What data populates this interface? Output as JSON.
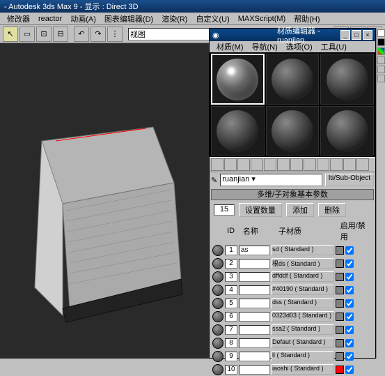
{
  "app": {
    "title": "- Autodesk 3ds Max 9 - 显示 : Direct 3D"
  },
  "menu": {
    "items": [
      "修改器",
      "reactor",
      "动画(A)",
      "图表编辑器(D)",
      "渲染(R)",
      "自定义(U)",
      "MAXScript(M)",
      "帮助(H)"
    ]
  },
  "viewport": {
    "label": "视图"
  },
  "material_editor": {
    "title": "材质编辑器 - ruanjian",
    "icon": "◉",
    "menu": [
      "材质(M)",
      "导航(N)",
      "选项(O)",
      "工具(U)"
    ],
    "name_field": "ruanjian",
    "type_button": "lti/Sub-Object",
    "rollout_title": "多维/子对象基本参数",
    "count": "15",
    "btn_set": "设置数量",
    "btn_add": "添加",
    "btn_del": "删除",
    "col_id": "ID",
    "col_name": "名称",
    "col_mat": "子材质",
    "col_enable": "启用/禁用",
    "subs": [
      {
        "id": "1",
        "name": "as",
        "mat": "sd ( Standard )",
        "swatch": "#808080",
        "on": true
      },
      {
        "id": "2",
        "name": "",
        "mat": "根ds ( Standard )",
        "swatch": "#808080",
        "on": true
      },
      {
        "id": "3",
        "name": "",
        "mat": "dffddf ( Standard )",
        "swatch": "#808080",
        "on": true
      },
      {
        "id": "4",
        "name": "",
        "mat": "#40190 ( Standard )",
        "swatch": "#808080",
        "on": true
      },
      {
        "id": "5",
        "name": "",
        "mat": "dss ( Standard )",
        "swatch": "#808080",
        "on": true
      },
      {
        "id": "6",
        "name": "",
        "mat": "0323d03 ( Standard )",
        "swatch": "#808080",
        "on": true
      },
      {
        "id": "7",
        "name": "",
        "mat": "ssa2 ( Standard )",
        "swatch": "#808080",
        "on": true
      },
      {
        "id": "8",
        "name": "",
        "mat": "Defaut ( Standard )",
        "swatch": "#808080",
        "on": true
      },
      {
        "id": "9",
        "name": "",
        "mat": "li ( Standard )",
        "swatch": "#808080",
        "on": true
      },
      {
        "id": "10",
        "name": "",
        "mat": "iaoshi ( Standard )",
        "swatch": "#ff0000",
        "on": true
      }
    ]
  }
}
